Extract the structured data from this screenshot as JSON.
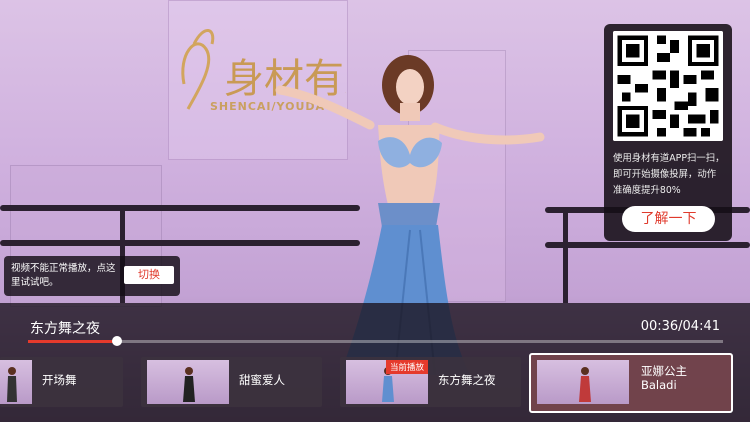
{
  "brand": {
    "logo_text": "身材有道",
    "logo_sub": "SHENCAI/YOUDAO"
  },
  "qr_card": {
    "description": "使用身材有道APP扫一扫，即可开始摄像投屏，动作准确度提升80%",
    "button_label": "了解一下"
  },
  "notice": {
    "text": "视频不能正常播放，点这里试试吧。",
    "switch_label": "切换"
  },
  "player": {
    "title": "东方舞之夜",
    "time": "00:36/04:41",
    "progress": 0.128
  },
  "episodes": [
    {
      "title": "开场舞",
      "subtitle": "",
      "badge": ""
    },
    {
      "title": "甜蜜爱人",
      "subtitle": "",
      "badge": ""
    },
    {
      "title": "东方舞之夜",
      "subtitle": "",
      "badge": "当前播放"
    },
    {
      "title": "亚娜公主",
      "subtitle": "Baladi",
      "badge": ""
    }
  ],
  "colors": {
    "accent": "#e53a2c",
    "overlay": "#19121c"
  }
}
